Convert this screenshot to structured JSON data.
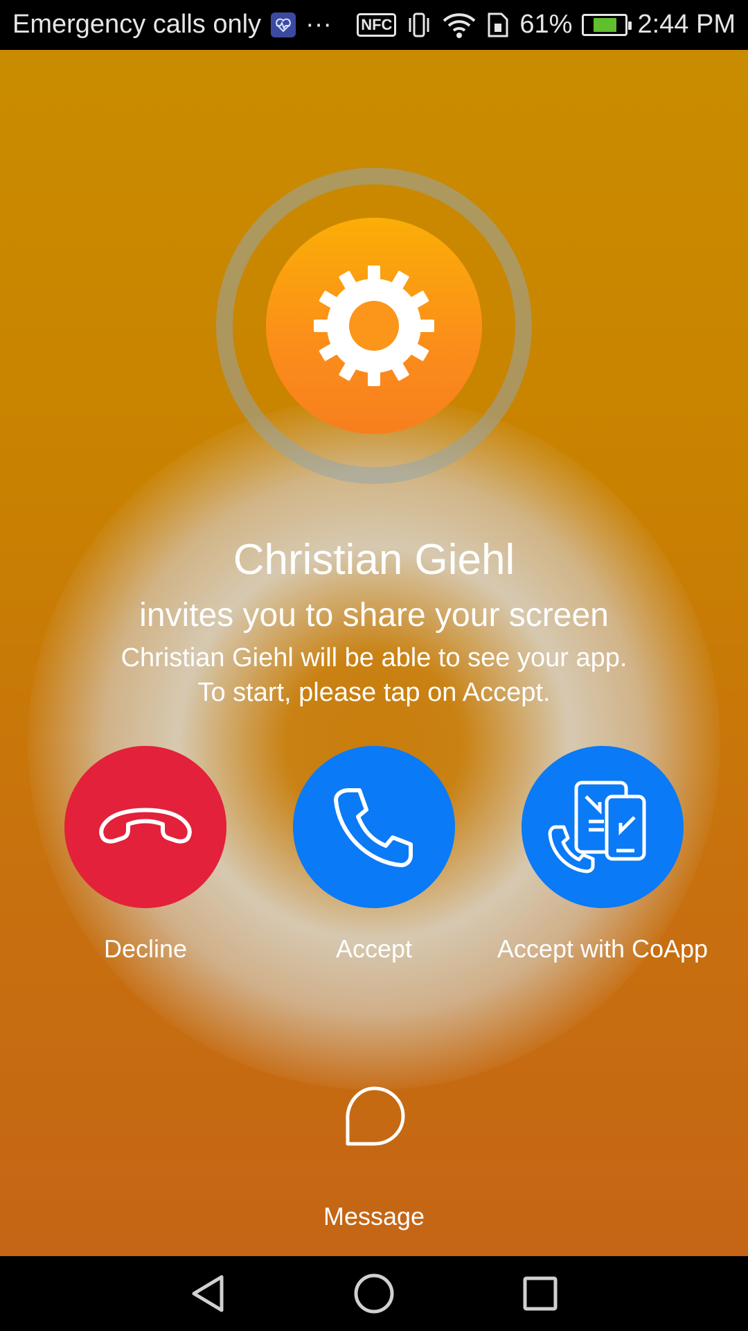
{
  "status_bar": {
    "carrier": "Emergency calls only",
    "more_indicator": "···",
    "nfc_label": "NFC",
    "battery_percent": "61%",
    "battery_level": 0.61,
    "time": "2:44 PM",
    "icons": [
      "health-app-icon",
      "nfc-icon",
      "vibrate-icon",
      "wifi-icon",
      "sim-icon",
      "battery-charging-icon"
    ]
  },
  "call": {
    "caller_name": "Christian Giehl",
    "invite_text": "invites you to share your screen",
    "info_line1": "Christian Giehl will be able to see your app.",
    "info_line2": "To start, please tap on Accept.",
    "avatar_icon": "gear-icon"
  },
  "actions": {
    "decline_label": "Decline",
    "accept_label": "Accept",
    "coapp_label": "Accept with CoApp",
    "message_label": "Message"
  },
  "colors": {
    "decline": "#e3213a",
    "accept": "#0a7af6",
    "avatar_top": "#fbae07",
    "avatar_bottom": "#f77f1e",
    "background_top": "#c98c00",
    "background_bottom": "#c56515"
  },
  "nav_bar": {
    "icons": [
      "back-icon",
      "home-icon",
      "recents-icon"
    ]
  }
}
